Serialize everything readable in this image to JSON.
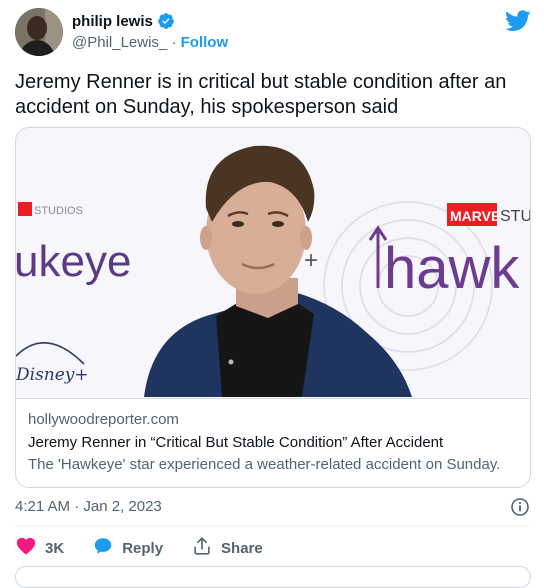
{
  "author": {
    "name": "philip lewis",
    "handle": "@Phil_Lewis_",
    "separator": "·",
    "follow_label": "Follow"
  },
  "tweet": {
    "text": "Jeremy Renner is in critical but stable condition after an accident on Sunday, his spokesperson said",
    "timestamp": "4:21 AM · Jan 2, 2023"
  },
  "card": {
    "domain": "hollywoodreporter.com",
    "title": "Jeremy Renner in “Critical But Stable Condition” After Accident",
    "description": "The 'Hawkeye' star experienced a weather-related accident on Sunday.",
    "image_text": {
      "backdrop_left": "ukeye",
      "studio_badge": "MARVEL",
      "studio_suffix": "STUD",
      "backdrop_right": "hawk",
      "disney_left": "Disney+",
      "plus_sign": "+"
    }
  },
  "actions": {
    "like_count": "3K",
    "reply_label": "Reply",
    "share_label": "Share"
  },
  "colors": {
    "accent": "#1d9bf0",
    "like": "#f91880",
    "muted": "#536471",
    "hawkeye_purple": "#6c3d8f",
    "marvel_red": "#ec1d24"
  },
  "icons": [
    "verified-badge-icon",
    "twitter-bird-icon",
    "info-icon",
    "heart-icon",
    "reply-bubble-icon",
    "share-icon"
  ]
}
